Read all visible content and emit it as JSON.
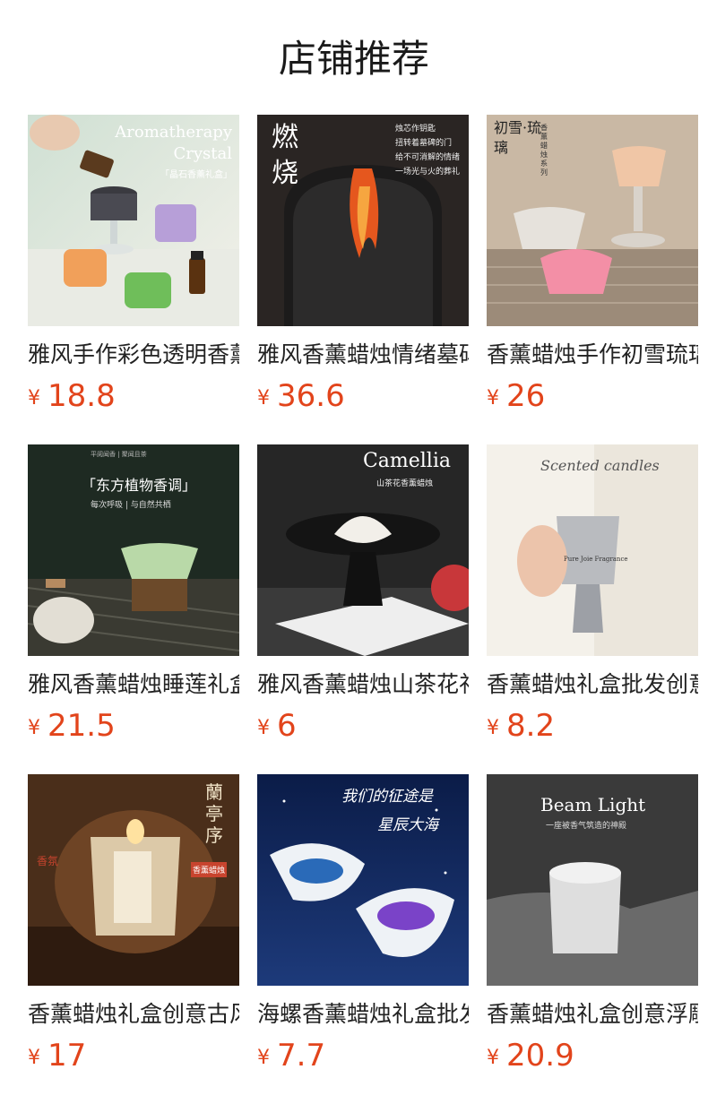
{
  "section": {
    "title": "店铺推荐",
    "currency_symbol": "¥"
  },
  "products": [
    {
      "name": "雅风手作彩色透明香薰晶石蜡烛",
      "price": "18.8",
      "image": {
        "text": [
          "Aromatherapy",
          "Crystal",
          "「晶石香薰礼盒」"
        ],
        "theme": "#d8e4d4"
      }
    },
    {
      "name": "雅风香薰蜡烛情绪墓碑",
      "price": "36.6",
      "image": {
        "text": [
          "燃",
          "烧",
          "烛芯作钥匙",
          "扭转着墓碑的门",
          "给不可消解的情绪",
          "一场光与火的葬礼"
        ],
        "theme": "#2a2523"
      }
    },
    {
      "name": "香薰蜡烛手作初雪琉璃",
      "price": "26",
      "image": {
        "text": [
          "初雪·琉璃",
          "香薰蜡烛系列"
        ],
        "theme": "#c9b8a4"
      }
    },
    {
      "name": "雅风香薰蜡烛睡莲礼盒",
      "price": "21.5",
      "image": {
        "text": [
          "「东方植物香调」",
          "每次呼吸 | 与自然共栖",
          "平阅闻香 | 聚闻且茶"
        ],
        "theme": "#1e2a22"
      }
    },
    {
      "name": "雅风香薰蜡烛山茶花礼盒",
      "price": "6",
      "image": {
        "text": [
          "Camellia",
          "山茶花香薰蜡烛"
        ],
        "theme": "#262626"
      }
    },
    {
      "name": "香薰蜡烛礼盒批发创意",
      "price": "8.2",
      "image": {
        "text": [
          "Scented candles",
          "Pure Joie Fragrance"
        ],
        "theme": "#ebe6dc"
      }
    },
    {
      "name": "香薰蜡烛礼盒创意古风",
      "price": "17",
      "image": {
        "text": [
          "蘭亭序",
          "香氛",
          "香薰蜡烛"
        ],
        "theme": "#4a2e1a"
      }
    },
    {
      "name": "海螺香薰蜡烛礼盒批发",
      "price": "7.7",
      "image": {
        "text": [
          "我们的征途是",
          "星辰大海"
        ],
        "theme": "#0b1c48"
      }
    },
    {
      "name": "香薰蜡烛礼盒创意浮雕",
      "price": "20.9",
      "image": {
        "text": [
          "Beam Light",
          "一座被香气筑造的神殿"
        ],
        "theme": "#3a3a3a"
      }
    }
  ]
}
